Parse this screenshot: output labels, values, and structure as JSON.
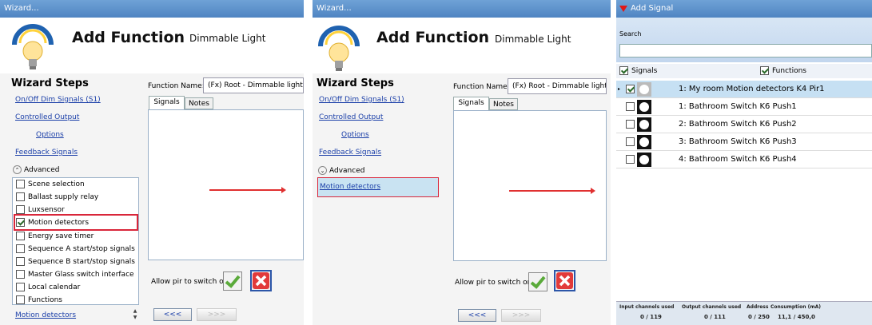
{
  "panel1": {
    "title": "Wizard...",
    "header_title": "Add Function",
    "header_subtitle": "Dimmable Light",
    "steps_title": "Wizard Steps",
    "steps": [
      "On/Off Dim Signals (S1)",
      "Controlled Output",
      "Options",
      "Feedback Signals"
    ],
    "advanced_label": "Advanced",
    "advanced_options": [
      {
        "label": "Scene selection",
        "checked": false
      },
      {
        "label": "Ballast supply relay",
        "checked": false
      },
      {
        "label": "Luxsensor",
        "checked": false
      },
      {
        "label": "Motion detectors",
        "checked": true
      },
      {
        "label": "Energy save timer",
        "checked": false
      },
      {
        "label": "Sequence A start/stop signals",
        "checked": false
      },
      {
        "label": "Sequence B start/stop signals",
        "checked": false
      },
      {
        "label": "Master Glass switch interface",
        "checked": false
      },
      {
        "label": "Local calendar",
        "checked": false
      },
      {
        "label": "Functions",
        "checked": false
      }
    ],
    "bottom_link": "Motion detectors",
    "function_name_label": "Function Name:",
    "function_name_value": "(Fx) Root - Dimmable light",
    "tabs": [
      "Signals",
      "Notes"
    ],
    "allow_pir_label": "Allow pir to switch on",
    "back_button": "<<<",
    "next_button": ">>>"
  },
  "panel2": {
    "title": "Wizard...",
    "header_title": "Add Function",
    "header_subtitle": "Dimmable Light",
    "steps_title": "Wizard Steps",
    "steps": [
      "On/Off Dim Signals (S1)",
      "Controlled Output",
      "Options",
      "Feedback Signals"
    ],
    "advanced_label": "Advanced",
    "selected_item": "Motion detectors",
    "function_name_label": "Function Name:",
    "function_name_value": "(Fx) Root - Dimmable light",
    "tabs": [
      "Signals",
      "Notes"
    ],
    "allow_pir_label": "Allow pir to switch on",
    "back_button": "<<<",
    "next_button": ">>>"
  },
  "panel3": {
    "title": "Add Signal",
    "search_label": "Search",
    "search_value": "",
    "signals_label": "Signals",
    "functions_label": "Functions",
    "signals": [
      {
        "label": "1: My room Motion detectors K4 Pir1",
        "checked": true,
        "icon": "pir-sensor-icon"
      },
      {
        "label": "1: Bathroom Switch K6 Push1",
        "checked": false,
        "icon": "push-button-icon"
      },
      {
        "label": "2: Bathroom Switch K6 Push2",
        "checked": false,
        "icon": "push-button-icon"
      },
      {
        "label": "3: Bathroom Switch K6 Push3",
        "checked": false,
        "icon": "push-button-icon"
      },
      {
        "label": "4: Bathroom Switch K6 Push4",
        "checked": false,
        "icon": "push-button-icon"
      }
    ],
    "footer": {
      "headers": [
        "Input channels used",
        "Output channels used",
        "Address",
        "Consumption (mA)"
      ],
      "values": [
        "0 / 119",
        "0 / 111",
        "0 / 250",
        "11,1 / 450,0"
      ]
    }
  }
}
